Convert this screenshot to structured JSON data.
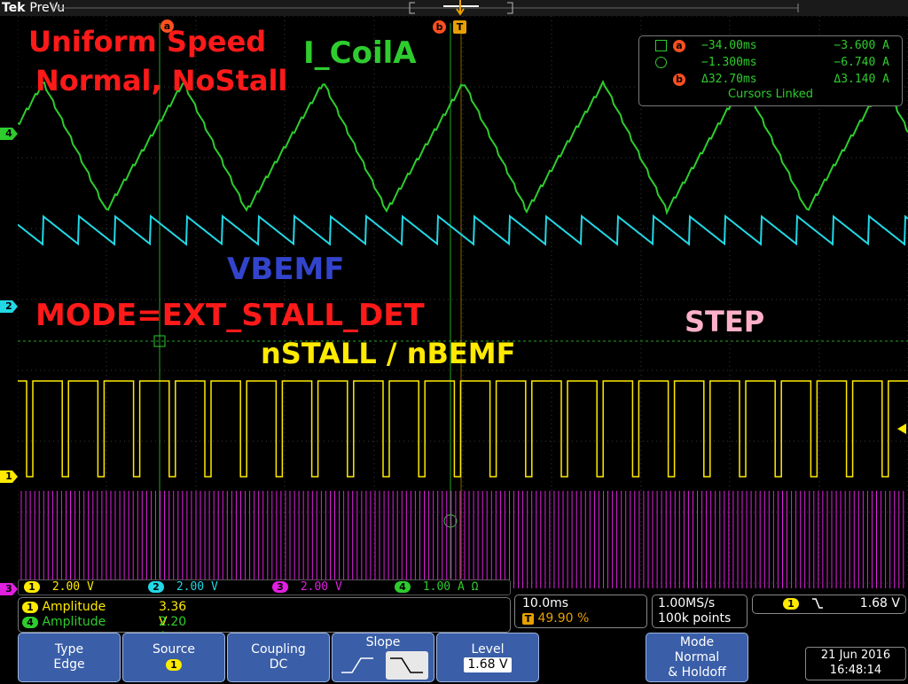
{
  "app": {
    "brand": "Tek",
    "mode": "PreVu"
  },
  "overlay_text": {
    "title_line1": "Uniform Speed",
    "title_line2": "Normal, NoStall",
    "coil_label": "I_CoilA",
    "vbemf_label": "VBEMF",
    "mode_label": "MODE=EXT_STALL_DET",
    "nstall_label": "nSTALL / nBEMF",
    "step_label": "STEP"
  },
  "markers": {
    "cursor_a": "a",
    "cursor_b": "b",
    "trigger": "T"
  },
  "channel_indicators": [
    {
      "id": "4",
      "color": "#2ecc2e"
    },
    {
      "id": "2",
      "color": "#22d8e6"
    },
    {
      "id": "1",
      "color": "#ffea00"
    },
    {
      "id": "3",
      "color": "#e020e0"
    }
  ],
  "cursors": {
    "rows": [
      {
        "marker": "a",
        "time": "−34.00ms",
        "value": "−3.600 A"
      },
      {
        "marker": "",
        "time": "−1.300ms",
        "value": "−6.740 A"
      },
      {
        "marker": "b",
        "time": "Δ32.70ms",
        "value": "Δ3.140 A"
      }
    ],
    "linked_text": "Cursors Linked"
  },
  "channels": [
    {
      "id": "1",
      "scale": "2.00 V",
      "color": "#ffea00"
    },
    {
      "id": "2",
      "scale": "2.00 V",
      "color": "#22d8e6"
    },
    {
      "id": "3",
      "scale": "2.00 V",
      "color": "#e020e0"
    },
    {
      "id": "4",
      "scale": "1.00 A Ω",
      "color": "#2ecc2e"
    }
  ],
  "measurements": [
    {
      "ch": "1",
      "label": "Amplitude",
      "value": "3.36 V",
      "color": "#ffea00"
    },
    {
      "ch": "4",
      "label": "Amplitude",
      "value": "2.20 A",
      "color": "#2ecc2e"
    }
  ],
  "timebase": {
    "scale": "10.0ms",
    "position": "49.90 %",
    "trigger_marker": "T"
  },
  "acquisition": {
    "rate": "1.00MS/s",
    "points": "100k points"
  },
  "trigger_readout": {
    "ch": "1",
    "slope_symbol": "⫽",
    "level": "1.68 V"
  },
  "softkeys": {
    "type": {
      "label": "Type",
      "value": "Edge"
    },
    "source": {
      "label": "Source",
      "value": "1"
    },
    "coupling": {
      "label": "Coupling",
      "value": "DC"
    },
    "slope": {
      "label": "Slope"
    },
    "level": {
      "label": "Level",
      "value": "1.68 V"
    },
    "mode": {
      "label": "Mode",
      "value1": "Normal",
      "value2": "& Holdoff"
    }
  },
  "datetime": {
    "date": "21 Jun 2016",
    "time": "16:48:14"
  },
  "colors": {
    "ch1": "#ffea00",
    "ch2": "#22d8e6",
    "ch3": "#e020e0",
    "ch4": "#2ecc2e",
    "accent": "#3a5ea8"
  }
}
